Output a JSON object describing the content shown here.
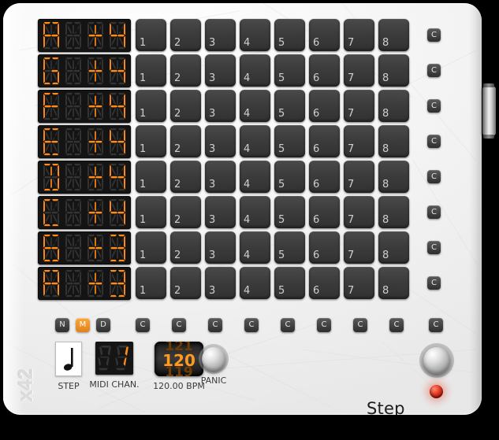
{
  "plugin": {
    "brand": "x42",
    "title": "Step Sequencer"
  },
  "rows": [
    {
      "note": [
        "A",
        " ",
        "#",
        "4"
      ],
      "steps": [
        "1",
        "2",
        "3",
        "4",
        "5",
        "6",
        "7",
        "8"
      ],
      "clear": "C"
    },
    {
      "note": [
        "G",
        " ",
        "#",
        "4"
      ],
      "steps": [
        "1",
        "2",
        "3",
        "4",
        "5",
        "6",
        "7",
        "8"
      ],
      "clear": "C"
    },
    {
      "note": [
        "F",
        " ",
        "#",
        "4"
      ],
      "steps": [
        "1",
        "2",
        "3",
        "4",
        "5",
        "6",
        "7",
        "8"
      ],
      "clear": "C"
    },
    {
      "note": [
        "E",
        " ",
        "#",
        "4"
      ],
      "steps": [
        "1",
        "2",
        "3",
        "4",
        "5",
        "6",
        "7",
        "8"
      ],
      "clear": "C"
    },
    {
      "note": [
        "D",
        " ",
        "#",
        "4"
      ],
      "steps": [
        "1",
        "2",
        "3",
        "4",
        "5",
        "6",
        "7",
        "8"
      ],
      "clear": "C"
    },
    {
      "note": [
        "C",
        " ",
        "#",
        "4"
      ],
      "steps": [
        "1",
        "2",
        "3",
        "4",
        "5",
        "6",
        "7",
        "8"
      ],
      "clear": "C"
    },
    {
      "note": [
        "b",
        " ",
        "#",
        "3"
      ],
      "steps": [
        "1",
        "2",
        "3",
        "4",
        "5",
        "6",
        "7",
        "8"
      ],
      "clear": "C"
    },
    {
      "note": [
        "A",
        " ",
        "#",
        "3"
      ],
      "steps": [
        "1",
        "2",
        "3",
        "4",
        "5",
        "6",
        "7",
        "8"
      ],
      "clear": "C"
    }
  ],
  "mode_buttons": [
    {
      "label": "N",
      "active": false
    },
    {
      "label": "M",
      "active": true
    },
    {
      "label": "D",
      "active": false
    }
  ],
  "column_clear_buttons": [
    "C",
    "C",
    "C",
    "C",
    "C",
    "C",
    "C",
    "C"
  ],
  "row_clear_all": "C",
  "controls": {
    "step": {
      "caption": "STEP",
      "icon": "quarter-note-icon"
    },
    "midi_channel": {
      "caption": "MIDI CHAN.",
      "value": "1"
    },
    "bpm": {
      "caption": "120.00 BPM",
      "prev": "121",
      "current": "120",
      "next": "119"
    },
    "panic": {
      "caption": "PANIC"
    }
  },
  "colors": {
    "panel": "#f2f2f2",
    "segment_on": "#ff8c1a",
    "segment_off": "#343434",
    "accent": "#e2801a",
    "led": "#e43b21"
  }
}
